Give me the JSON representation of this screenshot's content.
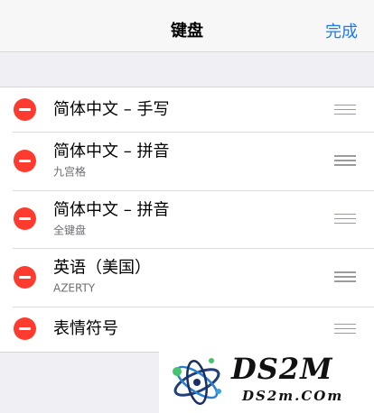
{
  "navbar": {
    "title": "键盘",
    "done_label": "完成"
  },
  "keyboards": [
    {
      "title": "简体中文 – 手写",
      "subtitle": ""
    },
    {
      "title": "简体中文 – 拼音",
      "subtitle": "九宫格"
    },
    {
      "title": "简体中文 – 拼音",
      "subtitle": "全键盘"
    },
    {
      "title": "英语（美国）",
      "subtitle": "AZERTY"
    },
    {
      "title": "表情符号",
      "subtitle": ""
    }
  ],
  "icons": {
    "delete": "minus-circle-icon",
    "reorder": "reorder-handle-icon"
  },
  "colors": {
    "accent": "#1a7cf0",
    "delete": "#ff3b30",
    "background": "#efeff4"
  },
  "watermark": {
    "title": "DS2M",
    "subtitle": "DS2m.COm"
  }
}
